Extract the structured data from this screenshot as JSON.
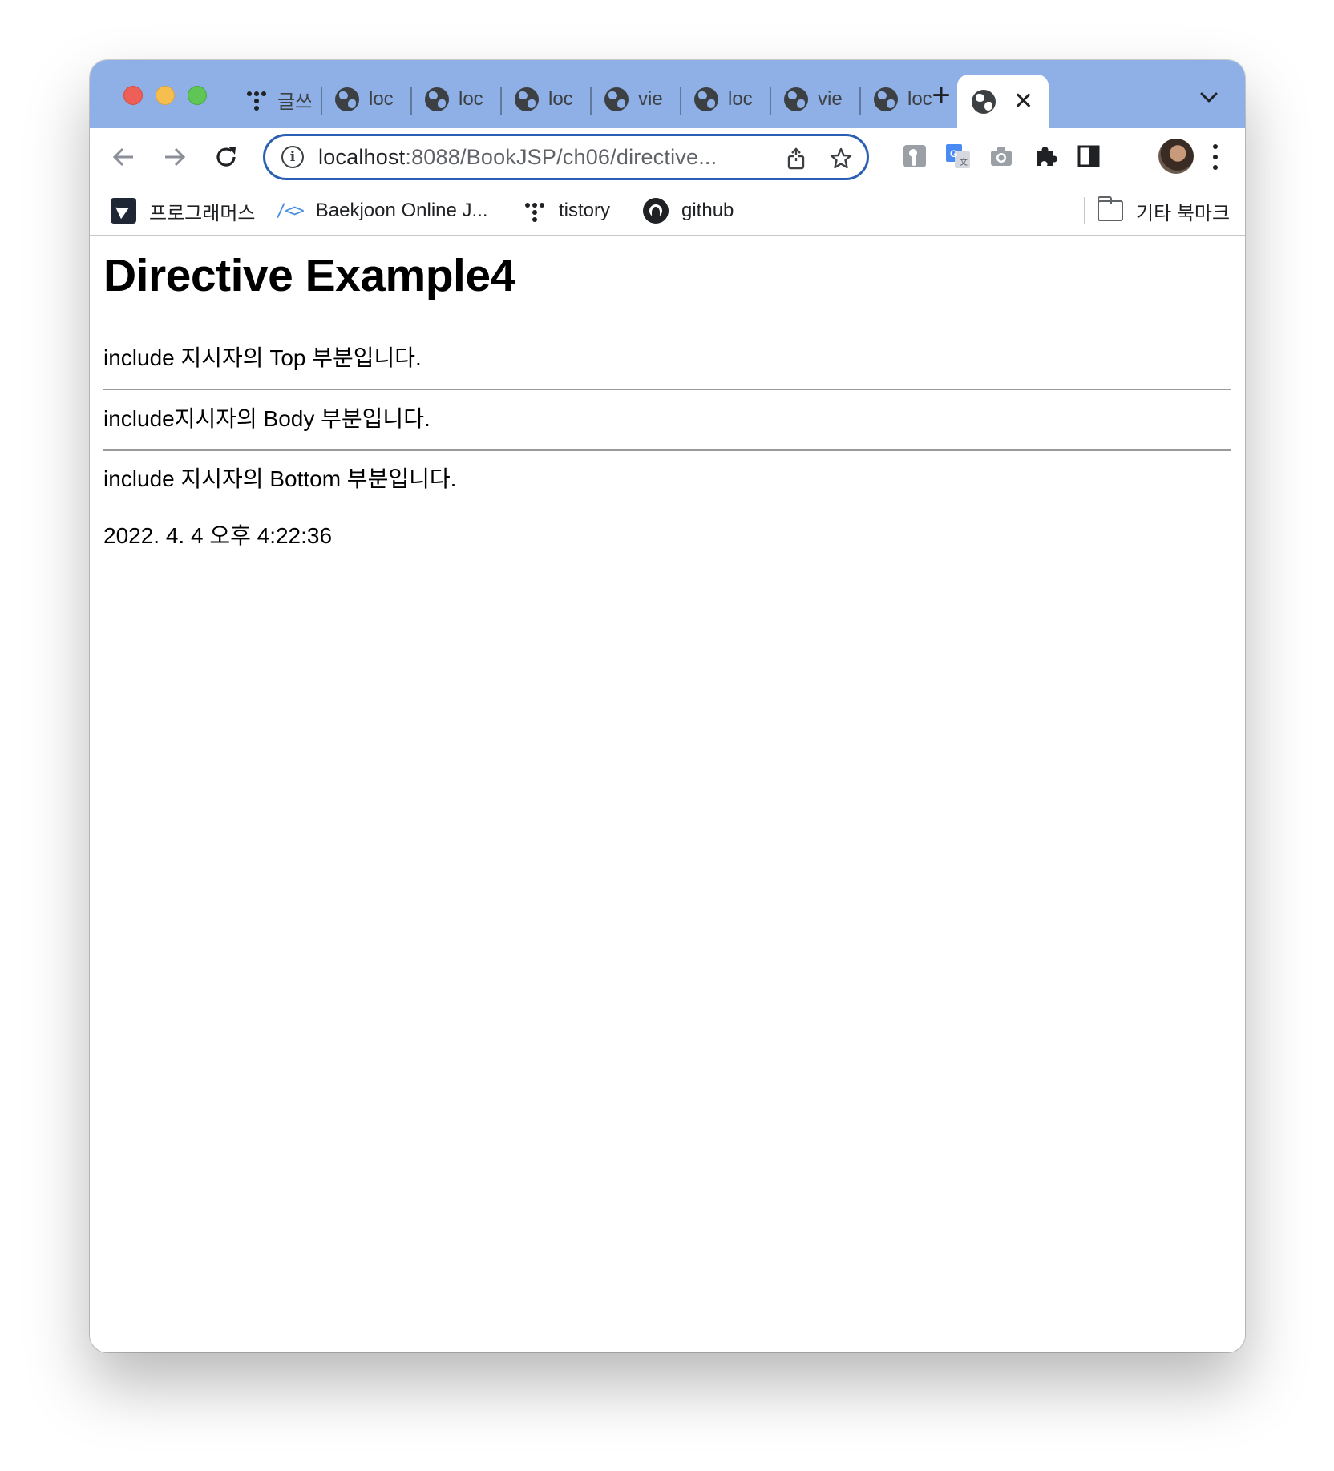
{
  "browser": {
    "tabs": [
      {
        "label": "글쓰",
        "icon": "tistory-dots-icon",
        "active": false
      },
      {
        "label": "loc",
        "icon": "globe-icon",
        "active": false
      },
      {
        "label": "loc",
        "icon": "globe-icon",
        "active": false
      },
      {
        "label": "loc",
        "icon": "globe-icon",
        "active": false
      },
      {
        "label": "vie",
        "icon": "globe-icon",
        "active": false
      },
      {
        "label": "loc",
        "icon": "globe-icon",
        "active": false
      },
      {
        "label": "vie",
        "icon": "globe-icon",
        "active": false
      },
      {
        "label": "loc",
        "icon": "globe-icon",
        "active": false
      },
      {
        "label": "",
        "icon": "globe-icon",
        "active": true
      }
    ],
    "address": {
      "host": "localhost",
      "rest": ":8088/BookJSP/ch06/directive..."
    },
    "bookmarks": [
      {
        "label": "프로그래머스",
        "icon": "programmers-icon"
      },
      {
        "label": "Baekjoon Online J...",
        "icon": "boj-icon"
      },
      {
        "label": "tistory",
        "icon": "tistory-dots-icon"
      },
      {
        "label": "github",
        "icon": "github-icon"
      }
    ],
    "other_bookmarks": "기타 북마크",
    "boj_icon_glyph": "/<>",
    "colors": {
      "tab_strip": "#8fb0e6",
      "omnibox_border": "#2b5fb4",
      "active_tab": "#ffffff"
    }
  },
  "page": {
    "heading": "Directive Example4",
    "top_text": "include 지시자의 Top 부분입니다.",
    "body_text": "include지시자의 Body 부분입니다.",
    "bottom_text": "include 지시자의 Bottom 부분입니다.",
    "timestamp": "2022. 4. 4 오후 4:22:36"
  }
}
